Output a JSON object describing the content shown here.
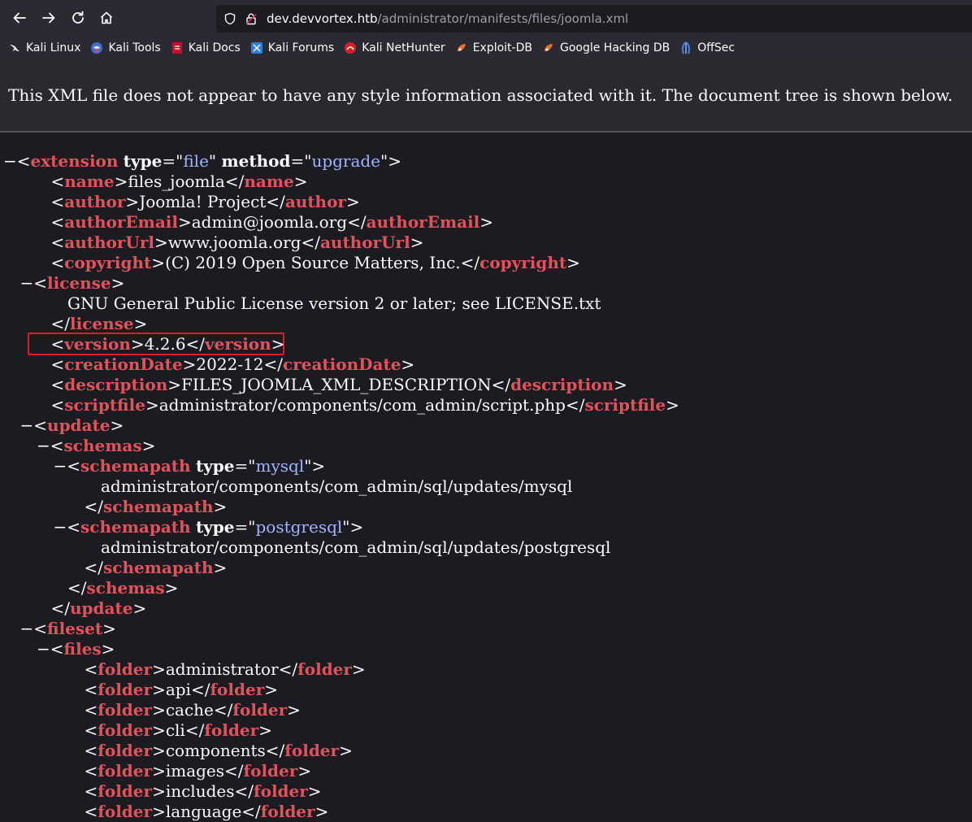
{
  "browser": {
    "url_host": "dev.devvortex.htb",
    "url_path": "/administrator/manifests/files/joomla.xml",
    "bookmarks": [
      {
        "label": "Kali Linux",
        "icon": "kali-dragon-icon"
      },
      {
        "label": "Kali Tools",
        "icon": "kali-tools-icon"
      },
      {
        "label": "Kali Docs",
        "icon": "kali-docs-icon"
      },
      {
        "label": "Kali Forums",
        "icon": "kali-forums-icon"
      },
      {
        "label": "Kali NetHunter",
        "icon": "kali-nethunter-icon"
      },
      {
        "label": "Exploit-DB",
        "icon": "exploit-db-icon"
      },
      {
        "label": "Google Hacking DB",
        "icon": "ghdb-icon"
      },
      {
        "label": "OffSec",
        "icon": "offsec-icon"
      }
    ]
  },
  "xml": {
    "notice": "This XML file does not appear to have any style information associated with it. The document tree is shown below.",
    "lines": [
      {
        "depth": 0,
        "kind": "open",
        "toggle": true,
        "tag": "extension",
        "attrs": [
          {
            "n": "type",
            "v": "file"
          },
          {
            "n": "method",
            "v": "upgrade"
          }
        ]
      },
      {
        "depth": 1,
        "kind": "elem",
        "tag": "name",
        "text": "files_joomla"
      },
      {
        "depth": 1,
        "kind": "elem",
        "tag": "author",
        "text": "Joomla! Project"
      },
      {
        "depth": 1,
        "kind": "elem",
        "tag": "authorEmail",
        "text": "admin@joomla.org"
      },
      {
        "depth": 1,
        "kind": "elem",
        "tag": "authorUrl",
        "text": "www.joomla.org"
      },
      {
        "depth": 1,
        "kind": "elem",
        "tag": "copyright",
        "text": "(C) 2019 Open Source Matters, Inc."
      },
      {
        "depth": 1,
        "kind": "open",
        "toggle": true,
        "tag": "license",
        "attrs": []
      },
      {
        "depth": 2,
        "kind": "text",
        "text": "GNU General Public License version 2 or later; see LICENSE.txt"
      },
      {
        "depth": 1,
        "kind": "close",
        "tag": "license"
      },
      {
        "depth": 1,
        "kind": "elem",
        "tag": "version",
        "text": "4.2.6",
        "highlight": true
      },
      {
        "depth": 1,
        "kind": "elem",
        "tag": "creationDate",
        "text": "2022-12"
      },
      {
        "depth": 1,
        "kind": "elem",
        "tag": "description",
        "text": "FILES_JOOMLA_XML_DESCRIPTION"
      },
      {
        "depth": 1,
        "kind": "elem",
        "tag": "scriptfile",
        "text": "administrator/components/com_admin/script.php"
      },
      {
        "depth": 1,
        "kind": "open",
        "toggle": true,
        "tag": "update",
        "attrs": []
      },
      {
        "depth": 2,
        "kind": "open",
        "toggle": true,
        "tag": "schemas",
        "attrs": []
      },
      {
        "depth": 3,
        "kind": "open",
        "toggle": true,
        "tag": "schemapath",
        "attrs": [
          {
            "n": "type",
            "v": "mysql"
          }
        ]
      },
      {
        "depth": 4,
        "kind": "text",
        "text": "administrator/components/com_admin/sql/updates/mysql"
      },
      {
        "depth": 3,
        "kind": "close",
        "tag": "schemapath"
      },
      {
        "depth": 3,
        "kind": "open",
        "toggle": true,
        "tag": "schemapath",
        "attrs": [
          {
            "n": "type",
            "v": "postgresql"
          }
        ]
      },
      {
        "depth": 4,
        "kind": "text",
        "text": "administrator/components/com_admin/sql/updates/postgresql"
      },
      {
        "depth": 3,
        "kind": "close",
        "tag": "schemapath"
      },
      {
        "depth": 2,
        "kind": "close",
        "tag": "schemas"
      },
      {
        "depth": 1,
        "kind": "close",
        "tag": "update"
      },
      {
        "depth": 1,
        "kind": "open",
        "toggle": true,
        "tag": "fileset",
        "attrs": []
      },
      {
        "depth": 2,
        "kind": "open",
        "toggle": true,
        "tag": "files",
        "attrs": []
      },
      {
        "depth": 3,
        "kind": "elem",
        "tag": "folder",
        "text": "administrator"
      },
      {
        "depth": 3,
        "kind": "elem",
        "tag": "folder",
        "text": "api"
      },
      {
        "depth": 3,
        "kind": "elem",
        "tag": "folder",
        "text": "cache"
      },
      {
        "depth": 3,
        "kind": "elem",
        "tag": "folder",
        "text": "cli"
      },
      {
        "depth": 3,
        "kind": "elem",
        "tag": "folder",
        "text": "components"
      },
      {
        "depth": 3,
        "kind": "elem",
        "tag": "folder",
        "text": "images"
      },
      {
        "depth": 3,
        "kind": "elem",
        "tag": "folder",
        "text": "includes"
      },
      {
        "depth": 3,
        "kind": "elem",
        "tag": "folder",
        "text": "language"
      }
    ]
  }
}
